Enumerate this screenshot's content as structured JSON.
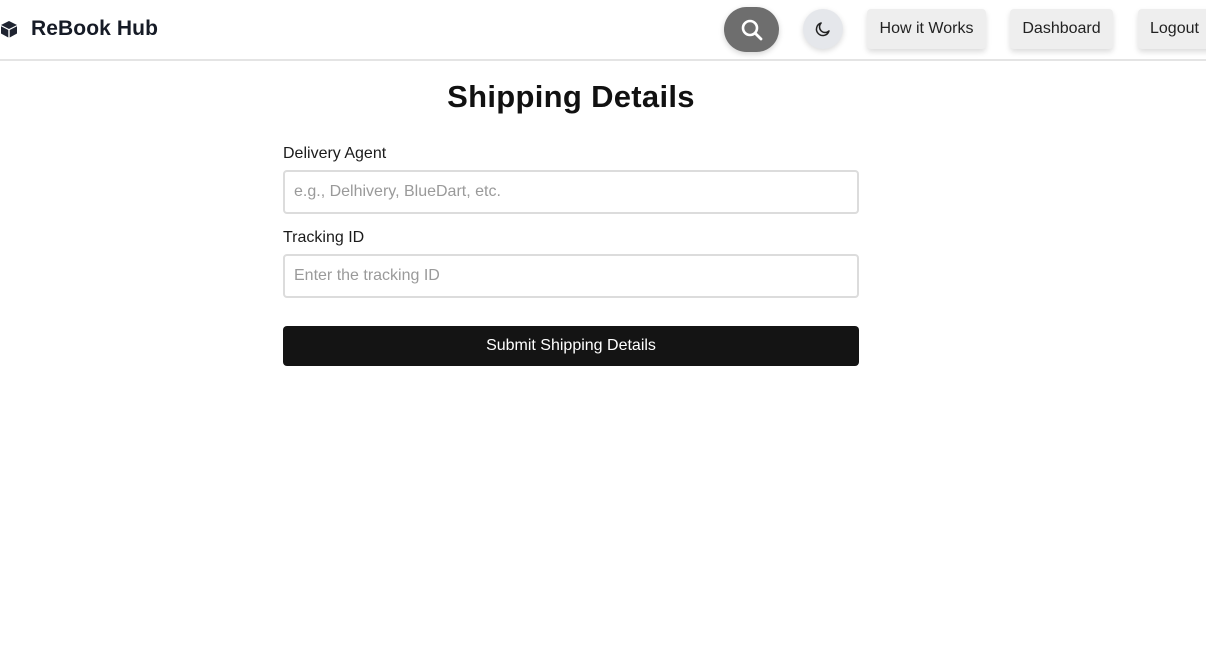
{
  "navbar": {
    "brand_name": "ReBook Hub",
    "brand_icon": "cube-icon",
    "search_icon": "search-icon",
    "theme_icon": "moon-icon",
    "links": [
      "How it Works",
      "Dashboard",
      "Logout"
    ]
  },
  "form": {
    "title": "Shipping Details",
    "delivery_agent": {
      "label": "Delivery Agent",
      "value": "",
      "placeholder": "e.g., Delhivery, BlueDart, etc."
    },
    "tracking_id": {
      "label": "Tracking ID",
      "value": "",
      "placeholder": "Enter the tracking ID"
    },
    "submit_label": "Submit Shipping Details"
  },
  "colors": {
    "accent": "#141414",
    "search_button": "#6e6e6e",
    "theme_button": "#e5e7eb",
    "nav_button": "#eeeeee"
  }
}
